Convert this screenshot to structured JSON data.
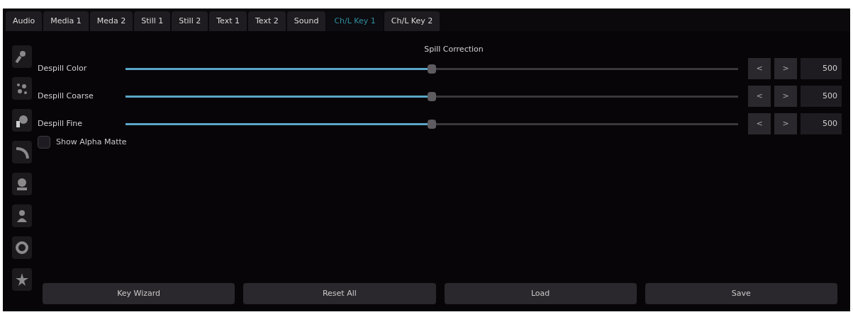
{
  "tabs": [
    {
      "label": "Audio",
      "selected": false
    },
    {
      "label": "Media 1",
      "selected": false
    },
    {
      "label": "Meda 2",
      "selected": false
    },
    {
      "label": "Still 1",
      "selected": false
    },
    {
      "label": "Still 2",
      "selected": false
    },
    {
      "label": "Text 1",
      "selected": false
    },
    {
      "label": "Text 2",
      "selected": false
    },
    {
      "label": "Sound",
      "selected": false
    },
    {
      "label": "Ch/L Key 1",
      "selected": true
    },
    {
      "label": "Ch/L Key 2",
      "selected": false
    }
  ],
  "tool_icons": [
    {
      "kind": "brush"
    },
    {
      "kind": "sparkle"
    },
    {
      "kind": "gear"
    },
    {
      "kind": "arc"
    },
    {
      "kind": "bucket"
    },
    {
      "kind": "person"
    },
    {
      "kind": "ring"
    },
    {
      "kind": "star"
    }
  ],
  "section_title": "Spill Correction",
  "sliders": [
    {
      "label": "Despill Color",
      "level": 0.5,
      "decrement": "<",
      "increment": ">",
      "value": "500"
    },
    {
      "label": "Despill Coarse",
      "level": 0.5,
      "decrement": "<",
      "increment": ">",
      "value": "500"
    },
    {
      "label": "Despill Fine",
      "level": 0.5,
      "decrement": "<",
      "increment": ">",
      "value": "500"
    }
  ],
  "show_alpha_matte": {
    "label": "Show Alpha Matte",
    "checked": false
  },
  "buttons": [
    "Key Wizard",
    "Reset All",
    "Load",
    "Save"
  ]
}
